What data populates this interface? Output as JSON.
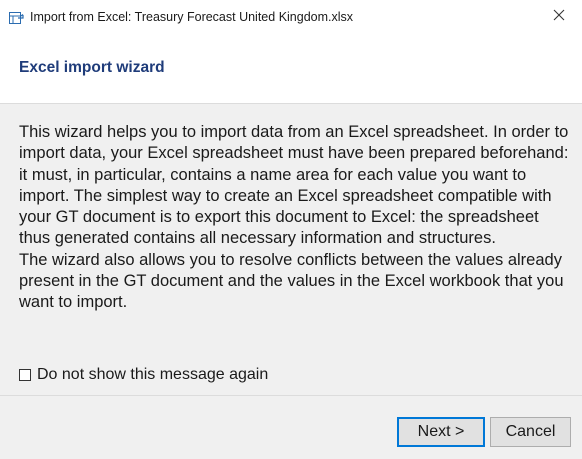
{
  "window": {
    "title": "Import from Excel: Treasury Forecast United Kingdom.xlsx",
    "close_glyph": "✕"
  },
  "header": {
    "title": "Excel import wizard"
  },
  "message": {
    "paragraph1": "This wizard helps you to import data from an Excel spreadsheet. In order to import data, your Excel spreadsheet must have been prepared beforehand: it must, in particular, contains a name area for each value you want to import. The simplest way to create an Excel spreadsheet compatible with your GT document is to export this document to Excel: the spreadsheet thus generated contains all necessary information and structures.",
    "paragraph2": "The wizard also allows you to resolve conflicts between the values already present in the GT document and the values in the Excel workbook that you want to import."
  },
  "checkbox": {
    "label": "Do not show this message again",
    "checked": false
  },
  "buttons": {
    "next_label": "Next >",
    "cancel_label": "Cancel"
  },
  "colors": {
    "header_title": "#1f3c7a",
    "default_button_border": "#0078d7",
    "panel_background": "#f0f0f0"
  },
  "icons": {
    "app": "excel-import-icon",
    "close": "close-icon"
  }
}
